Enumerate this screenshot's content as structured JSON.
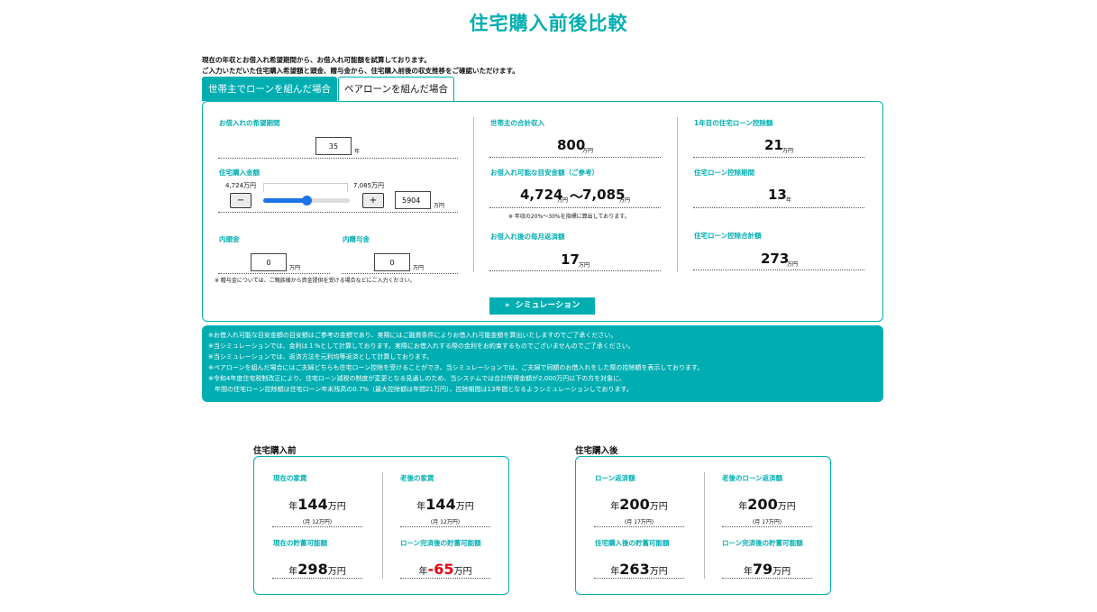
{
  "page": {
    "title": "住宅購入前後比較",
    "intro_line1": "現在の年収とお借入れ希望期間から、お借入れ可能額を試算しております。",
    "intro_line2": "ご入力いただいた住宅購入希望額と頭金、贈与金から、住宅購入前後の収支推移をご確認いただけます。"
  },
  "tabs": [
    {
      "label": "世帯主でローンを組んだ場合",
      "active": true
    },
    {
      "label": "ペアローンを組んだ場合",
      "active": false
    }
  ],
  "form": {
    "period_label": "お借入れの希望期間",
    "period_value": "35",
    "period_unit": "年",
    "price_label": "住宅購入金額",
    "slider_min_label": "4,724万円",
    "slider_max_label": "7,085万円",
    "slider_fraction": 0.5,
    "minus_label": "−",
    "plus_label": "+",
    "price_value": "5904",
    "price_unit": "万円",
    "down_label": "内頭金",
    "down_value": "0",
    "down_unit": "万円",
    "gift_label": "内贈与金",
    "gift_value": "0",
    "gift_unit": "万円",
    "gift_note": "※ 贈与金については、ご親族様から資金提供を受ける場合などにご入力ください。"
  },
  "results": {
    "income_label": "世帯主の合計収入",
    "income_value": "800",
    "income_unit": "万円",
    "borrow_label": "お借入れ可能な目安金額（ご参考）",
    "borrow_min": "4,724",
    "borrow_min_unit": "万円",
    "borrow_sep": "〜",
    "borrow_max": "7,085",
    "borrow_max_unit": "万円",
    "borrow_note": "※ 年収の20%〜30%を指標に算出しております。",
    "monthly_label": "お借入れ後の毎月返済額",
    "monthly_value": "17",
    "monthly_unit": "万円",
    "deduct1_label": "1年目の住宅ローン控除額",
    "deduct1_value": "21",
    "deduct1_unit": "万円",
    "deduct_period_label": "住宅ローン控除期間",
    "deduct_period_value": "13",
    "deduct_period_unit": "年",
    "deduct_total_label": "住宅ローン控除合計額",
    "deduct_total_value": "273",
    "deduct_total_unit": "万円"
  },
  "simulate_button": {
    "icon": "double-chevron-down-icon",
    "label": "シミュレーション"
  },
  "notes": [
    "※お借入れ可能な目安金額の目安額はご参考の金額であり、実際にはご融資条件によりお借入れ可能金額を算出いたしますのでご了承ください。",
    "※当シミュレーションでは、金利は１%として計算しております。実際にお借入れする際の金利をお約束するものでございませんのでご了承ください。",
    "※当シミュレーションでは、返済方法を元利均等返済として計算しております。",
    "※ペアローンを組んだ場合にはご夫婦どちらも住宅ローン控除を受けることができ、当シミュレーションでは、ご夫婦で同額のお借入れをした際の控除額を表示しております。",
    "※令和4年度住宅税制改正により、住宅ローン減税の制度が変更となる見通しのため、当システムでは合計所得金額が2,000万円以下の方を対象に、",
    "　年間の住宅ローン控除額は住宅ローン年末残高の0.7%（最大控除額は年間21万円）、控除期間は13年間となるようシミュレーションしております。"
  ],
  "before": {
    "title": "住宅購入前",
    "items": [
      {
        "label": "現在の家賃",
        "prefix": "年",
        "value": "144",
        "unit": "万円",
        "sub": "(月 12万円)"
      },
      {
        "label": "老後の家賃",
        "prefix": "年",
        "value": "144",
        "unit": "万円",
        "sub": "(月 12万円)"
      },
      {
        "label": "現在の貯蓄可能額",
        "prefix": "年",
        "value": "298",
        "unit": "万円",
        "sub": ""
      },
      {
        "label": "ローン完済後の貯蓄可能額",
        "prefix": "年",
        "value": "-65",
        "unit": "万円",
        "sub": ""
      }
    ]
  },
  "after": {
    "title": "住宅購入後",
    "items": [
      {
        "label": "ローン返済額",
        "prefix": "年",
        "value": "200",
        "unit": "万円",
        "sub": "(月 17万円)"
      },
      {
        "label": "老後のローン返済額",
        "prefix": "年",
        "value": "200",
        "unit": "万円",
        "sub": "(月 17万円)"
      },
      {
        "label": "住宅購入後の貯蓄可能額",
        "prefix": "年",
        "value": "263",
        "unit": "万円",
        "sub": ""
      },
      {
        "label": "ローン完済後の貯蓄可能額",
        "prefix": "年",
        "value": "79",
        "unit": "万円",
        "sub": ""
      }
    ]
  },
  "colors": {
    "accent": "#00aeb2",
    "negative": "#e60012",
    "slider": "#1a73e8"
  }
}
